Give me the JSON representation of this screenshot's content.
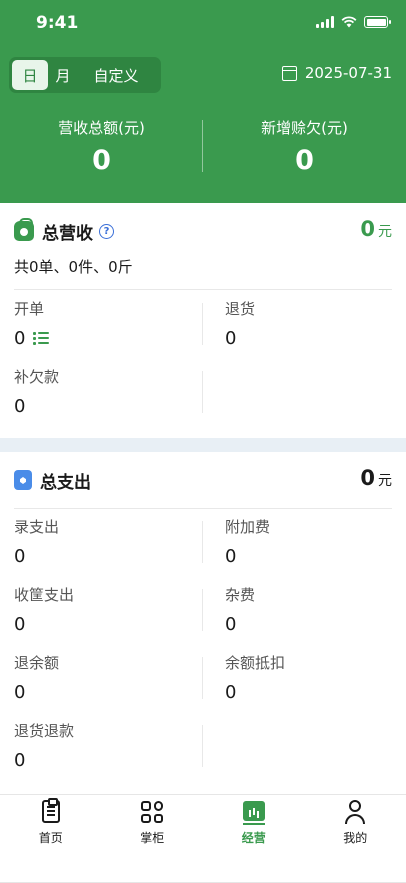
{
  "status_bar": {
    "time": "9:41"
  },
  "header": {
    "tabs": [
      {
        "label": "日",
        "active": true
      },
      {
        "label": "月",
        "active": false
      },
      {
        "label": "自定义",
        "active": false
      }
    ],
    "date": "2025-07-31",
    "summary": [
      {
        "label": "营收总额(元)",
        "value": "0"
      },
      {
        "label": "新增赊欠(元)",
        "value": "0"
      }
    ]
  },
  "revenue": {
    "title": "总营收",
    "amount": "0",
    "unit": "元",
    "detail": "共0单、0件、0斤",
    "items": [
      {
        "label": "开单",
        "value": "0"
      },
      {
        "label": "退货",
        "value": "0"
      },
      {
        "label": "补欠款",
        "value": "0"
      }
    ]
  },
  "expense": {
    "title": "总支出",
    "amount": "0",
    "unit": "元",
    "items": [
      {
        "label": "录支出",
        "value": "0"
      },
      {
        "label": "附加费",
        "value": "0"
      },
      {
        "label": "收筐支出",
        "value": "0"
      },
      {
        "label": "杂费",
        "value": "0"
      },
      {
        "label": "退余额",
        "value": "0"
      },
      {
        "label": "余额抵扣",
        "value": "0"
      },
      {
        "label": "退货退款",
        "value": "0"
      }
    ]
  },
  "tabbar": [
    {
      "label": "首页",
      "icon": "clipboard-icon",
      "active": false
    },
    {
      "label": "掌柜",
      "icon": "apps-grid-icon",
      "active": false
    },
    {
      "label": "经营",
      "icon": "chart-icon",
      "active": true
    },
    {
      "label": "我的",
      "icon": "user-icon",
      "active": false
    }
  ],
  "colors": {
    "brand_green": "#3a9a4e",
    "accent_blue": "#4a8ce8",
    "band": "#e8eff5"
  }
}
